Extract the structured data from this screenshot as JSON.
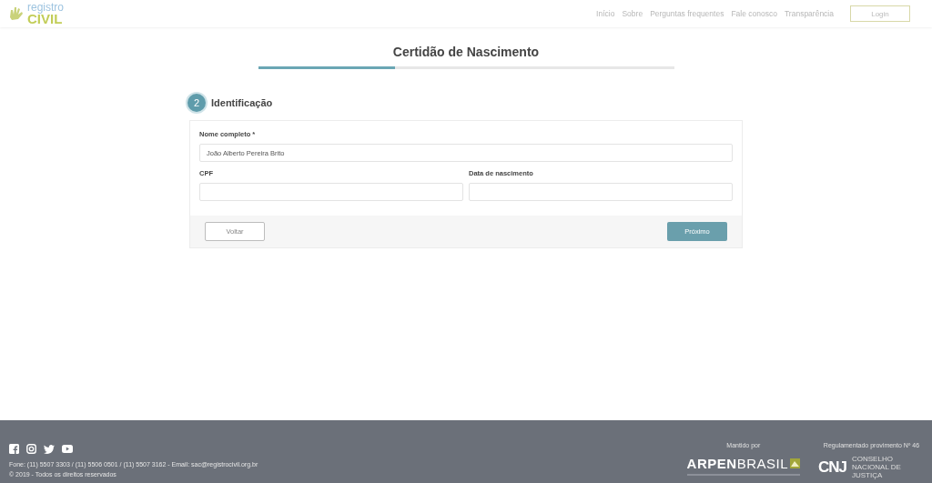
{
  "header": {
    "logo": {
      "top": "registro",
      "bottom": "CIVIL"
    },
    "nav": [
      {
        "label": "Início"
      },
      {
        "label": "Sobre"
      },
      {
        "label": "Perguntas frequentes"
      },
      {
        "label": "Fale conosco"
      },
      {
        "label": "Transparência"
      }
    ],
    "login": "Login"
  },
  "title": "Certidão de Nascimento",
  "progress": {
    "level": 0.33
  },
  "step": {
    "number": "2",
    "label": "Identificação"
  },
  "form": {
    "fields": [
      {
        "label": "Nome completo *",
        "value": "João Alberto Pereira Brito",
        "wide": true
      },
      {
        "label": "CPF",
        "wide": false
      },
      {
        "label": "Data de nascimento",
        "wide": false
      }
    ],
    "back": "Voltar",
    "next": "Próximo"
  },
  "footer": {
    "contact": "Fone: (11) 5507 3303 / (11) 5506 0501 / (11) 5507 3162 - Email: sac@registrocivil.org.br",
    "copyright": "© 2019 - Todos os direitos reservados",
    "maintained_by": "Mantido por",
    "arpen": {
      "bold": "ARPEN",
      "light": "BRASIL"
    },
    "regulated": "Regulamentado provimento Nº 46",
    "cnj": {
      "mark": "CNJ",
      "caption": "CONSELHO NACIONAL DE JUSTIÇA"
    }
  }
}
